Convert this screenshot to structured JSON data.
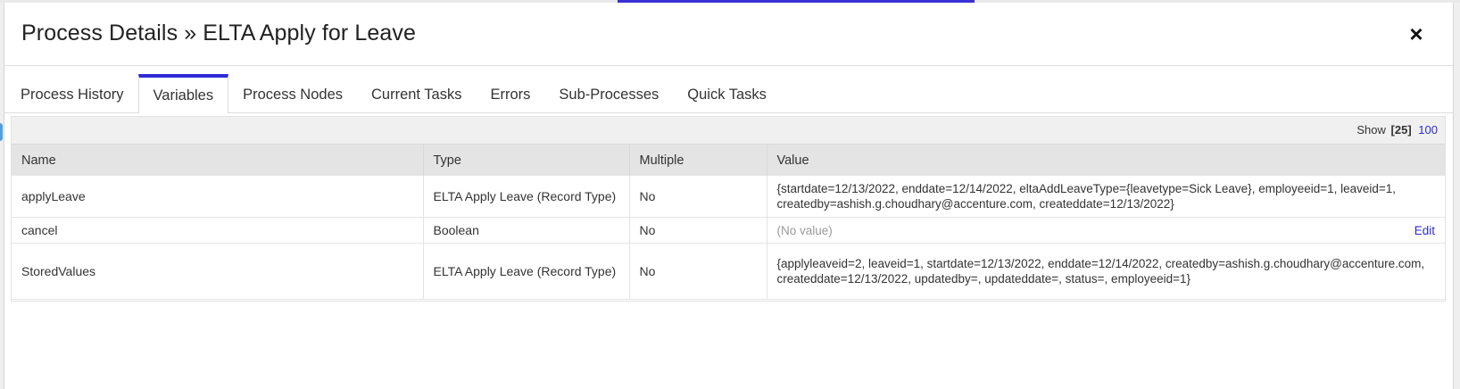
{
  "dialog": {
    "title": "Process Details » ELTA Apply for Leave",
    "close_icon": "×"
  },
  "tabs": [
    {
      "label": "Process History",
      "active": false
    },
    {
      "label": "Variables",
      "active": true
    },
    {
      "label": "Process Nodes",
      "active": false
    },
    {
      "label": "Current Tasks",
      "active": false
    },
    {
      "label": "Errors",
      "active": false
    },
    {
      "label": "Sub-Processes",
      "active": false
    },
    {
      "label": "Quick Tasks",
      "active": false
    }
  ],
  "pager": {
    "show_label": "Show",
    "current": "[25]",
    "option": "100"
  },
  "table": {
    "headers": [
      "Name",
      "Type",
      "Multiple",
      "Value"
    ],
    "rows": [
      {
        "name": "applyLeave",
        "type": "ELTA Apply Leave (Record Type)",
        "multiple": "No",
        "value": "{startdate=12/13/2022, enddate=12/14/2022, eltaAddLeaveType={leavetype=Sick Leave}, employeeid=1, leaveid=1, createdby=ashish.g.choudhary@accenture.com, createddate=12/13/2022}"
      },
      {
        "name": "cancel",
        "type": "Boolean",
        "multiple": "No",
        "value": "(No value)",
        "action": "Edit"
      },
      {
        "name": "StoredValues",
        "type": "ELTA Apply Leave (Record Type)",
        "multiple": "No",
        "value": "{applyleaveid=2, leaveid=1, startdate=12/13/2022, enddate=12/14/2022, createdby=ashish.g.choudhary@accenture.com, createddate=12/13/2022, updatedby=, updateddate=, status=, employeeid=1}"
      }
    ]
  },
  "colors": {
    "accent": "#2e2bd6",
    "header_bg": "#e4e4e4",
    "toolbar_bg": "#f0f0f0"
  }
}
